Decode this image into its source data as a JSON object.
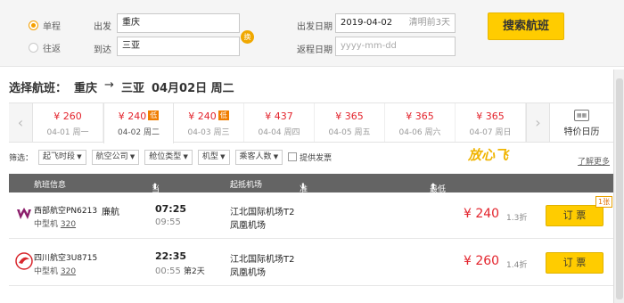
{
  "search": {
    "trip_types": [
      {
        "label": "单程",
        "selected": true
      },
      {
        "label": "往返",
        "selected": false
      }
    ],
    "from_label": "出发",
    "from_value": "重庆",
    "to_label": "到达",
    "to_value": "三亚",
    "swap_label": "换",
    "depart_label": "出发日期",
    "depart_value": "2019-04-02",
    "depart_hint": "清明前3天",
    "return_label": "返程日期",
    "return_placeholder": "yyyy-mm-dd",
    "submit_label": "搜索航班"
  },
  "route_title": {
    "prefix": "选择航班：",
    "from": "重庆",
    "arrow": "→",
    "to": "三亚",
    "date": "04月02日 周二"
  },
  "date_strip": {
    "prev_icon": "‹",
    "next_icon": "›",
    "days": [
      {
        "price": "¥ 260",
        "date": "04-01 周一",
        "low": "",
        "selected": false
      },
      {
        "price": "¥ 240",
        "date": "04-02 周二",
        "low": "低",
        "selected": true
      },
      {
        "price": "¥ 240",
        "date": "04-03 周三",
        "low": "低",
        "selected": false
      },
      {
        "price": "¥ 437",
        "date": "04-04 周四",
        "low": "",
        "selected": false
      },
      {
        "price": "¥ 365",
        "date": "04-05 周五",
        "low": "",
        "selected": false
      },
      {
        "price": "¥ 365",
        "date": "04-06 周六",
        "low": "",
        "selected": false
      },
      {
        "price": "¥ 365",
        "date": "04-07 周日",
        "low": "",
        "selected": false
      }
    ],
    "calendar_label": "特价日历"
  },
  "filters": {
    "label": "筛选：",
    "items": [
      "起飞时段",
      "航空公司",
      "舱位类型",
      "机型",
      "乘客人数"
    ],
    "checkbox_label": "提供发票",
    "promo_text": "放心飞",
    "learn_more": "了解更多"
  },
  "table": {
    "headers": {
      "flight": "航班信息",
      "time": "当地起降时间",
      "airport": "起抵机场",
      "ontime": "准点率",
      "price": "最低价格（不含税费）"
    },
    "rows": [
      {
        "airline": "西部航空PN6213",
        "share": "廉航",
        "plane": "中型机",
        "model": "320",
        "dep_time": "07:25",
        "arr_time": "09:55",
        "next_day": "",
        "dep_airport": "江北国际机场T2",
        "arr_airport": "凤凰机场",
        "price": "¥ 240",
        "discount": "1.3折",
        "book_label": "订 票",
        "tag": "1张",
        "logo_color": "#8b1e6b"
      },
      {
        "airline": "四川航空3U8715",
        "share": "",
        "plane": "中型机",
        "model": "320",
        "dep_time": "22:35",
        "arr_time": "00:55",
        "next_day": "第2天",
        "dep_airport": "江北国际机场T2",
        "arr_airport": "凤凰机场",
        "price": "¥ 260",
        "discount": "1.4折",
        "book_label": "订 票",
        "tag": "",
        "logo_color": "#d8272d"
      }
    ]
  }
}
